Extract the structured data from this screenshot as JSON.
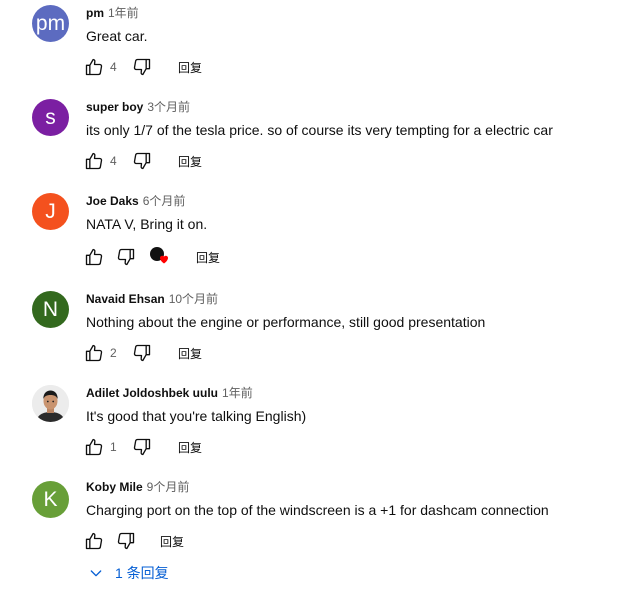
{
  "comments": [
    {
      "author": "pm",
      "time": "1年前",
      "text": "Great car.",
      "avatar_initial": "pm",
      "avatar_color": "#5c6bc0",
      "likes": "4",
      "reply_label": "回复"
    },
    {
      "author": "super boy",
      "time": "3个月前",
      "text": "its only 1/7 of the tesla price.  so of course its very tempting for a electric car",
      "avatar_initial": "s",
      "avatar_color": "#7b1fa2",
      "likes": "4",
      "reply_label": "回复"
    },
    {
      "author": "Joe Daks",
      "time": "6个月前",
      "text": "NATA V, Bring it on.",
      "avatar_initial": "J",
      "avatar_color": "#f4511e",
      "likes": "",
      "reply_label": "回复"
    },
    {
      "author": "Navaid Ehsan",
      "time": "10个月前",
      "text": "Nothing about the engine or performance, still good presentation",
      "avatar_initial": "N",
      "avatar_color": "#33691e",
      "likes": "2",
      "reply_label": "回复"
    },
    {
      "author": "Adilet Joldoshbek uulu",
      "time": "1年前",
      "text": "It's good that you're talking English)",
      "likes": "1",
      "reply_label": "回复"
    },
    {
      "author": "Koby Mile",
      "time": "9个月前",
      "text": "Charging port on the top of the windscreen is a +1 for dashcam connection",
      "avatar_initial": "K",
      "avatar_color": "#689f38",
      "likes": "",
      "reply_label": "回复"
    }
  ],
  "replies_toggle": {
    "label": "1 条回复",
    "color": "#065fd4"
  },
  "colors": {
    "heart": "#ff0000",
    "meta_gray": "#606060"
  }
}
